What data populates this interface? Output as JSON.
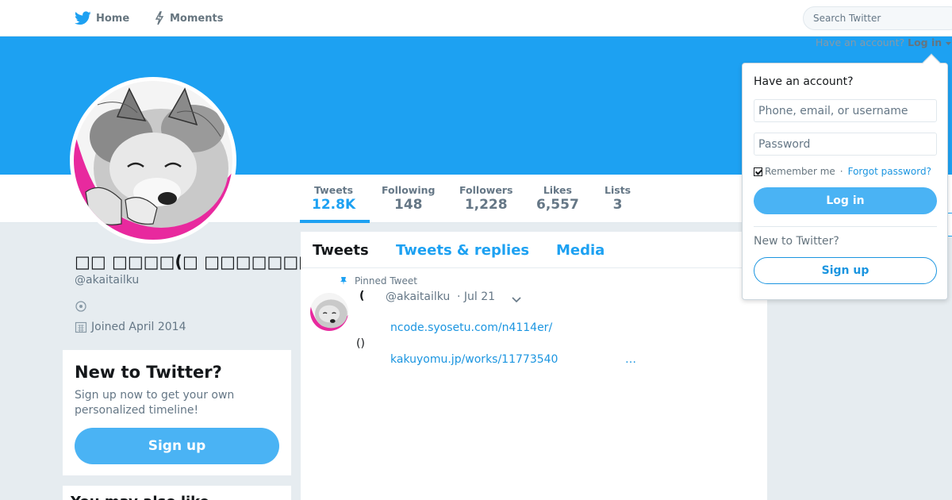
{
  "nav": {
    "home_label": "Home",
    "moments_label": "Moments",
    "search_placeholder": "Search Twitter",
    "have_account": "Have an account?",
    "login_link": "Log in"
  },
  "profile": {
    "name": "□□ □□□□(□ □□□□□□□□□□",
    "handle": "@akaitailku",
    "joined": "Joined April 2014"
  },
  "stats": [
    {
      "label": "Tweets",
      "value": "12.8K"
    },
    {
      "label": "Following",
      "value": "148"
    },
    {
      "label": "Followers",
      "value": "1,228"
    },
    {
      "label": "Likes",
      "value": "6,557"
    },
    {
      "label": "Lists",
      "value": "3"
    }
  ],
  "signup_card": {
    "title": "New to Twitter?",
    "text": "Sign up now to get your own personalized timeline!",
    "button": "Sign up"
  },
  "next_card": {
    "title": "You may also like"
  },
  "timeline": {
    "tabs": [
      "Tweets",
      "Tweets & replies",
      "Media"
    ],
    "pinned_label": "Pinned Tweet",
    "tweet": {
      "name": "(",
      "handle": "@akaitailku",
      "date": "· Jul 21",
      "link1": "ncode.syosetu.com/n4114er/",
      "paren": "()",
      "link2": "kakuyomu.jp/works/11773540",
      "ellipsis": "…"
    }
  },
  "login": {
    "title": "Have an account?",
    "user_placeholder": "Phone, email, or username",
    "pass_placeholder": "Password",
    "remember": "Remember me",
    "separator": "·",
    "forgot": "Forgot password?",
    "login_button": "Log in",
    "new_label": "New to Twitter?",
    "signup_button": "Sign up"
  },
  "colors": {
    "brand": "#1da1f2",
    "button": "#4ab3f4",
    "link": "#1b95e0"
  }
}
